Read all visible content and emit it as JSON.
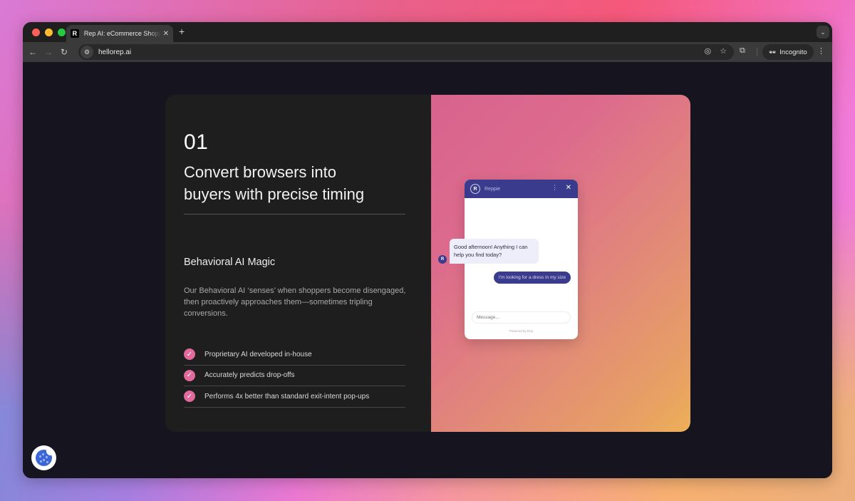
{
  "browser": {
    "tab_title": "Rep AI: eCommerce Shopping Assistant",
    "tab_favicon": "R",
    "tab_close": "✕",
    "new_tab": "+",
    "tab_menu": "⌄",
    "url": "hellorep.ai",
    "nav": {
      "back": "←",
      "forward": "→",
      "reload": "↻"
    },
    "site_info_icon": "⚙",
    "eye_off_icon": "◎",
    "star_icon": "☆",
    "extensions_icon": "⧉",
    "incognito_label": "Incognito",
    "incognito_icon": "🕶",
    "menu_icon": "⋮"
  },
  "feature_card": {
    "number": "01",
    "headline_line1": "Convert browsers into",
    "headline_line2": "buyers with precise timing",
    "subheading": "Behavioral AI Magic",
    "description": "Our Behavioral AI ‘senses’ when shoppers become disengaged, then proactively approaches them—sometimes tripling conversions.",
    "check_glyph": "✓",
    "features": [
      {
        "label": "Proprietary AI developed in-house"
      },
      {
        "label": "Accurately predicts drop-offs"
      },
      {
        "label": "Performs 4x better than standard exit-intent pop-ups"
      }
    ],
    "accent_color": "#e06a9b"
  },
  "chat_widget": {
    "bot_name": "Reppie",
    "bot_logo": "R",
    "more_icon": "⋮",
    "close_icon": "✕",
    "bot_message": "Good afternoon! Anything I can help you find today?",
    "user_message": "I'm looking for a dress in my size",
    "input_placeholder": "Message...",
    "powered_by": "Powered by Rep",
    "brand_color": "#3a3b8c"
  },
  "cookie_button": {
    "icon": "cookie-icon"
  }
}
